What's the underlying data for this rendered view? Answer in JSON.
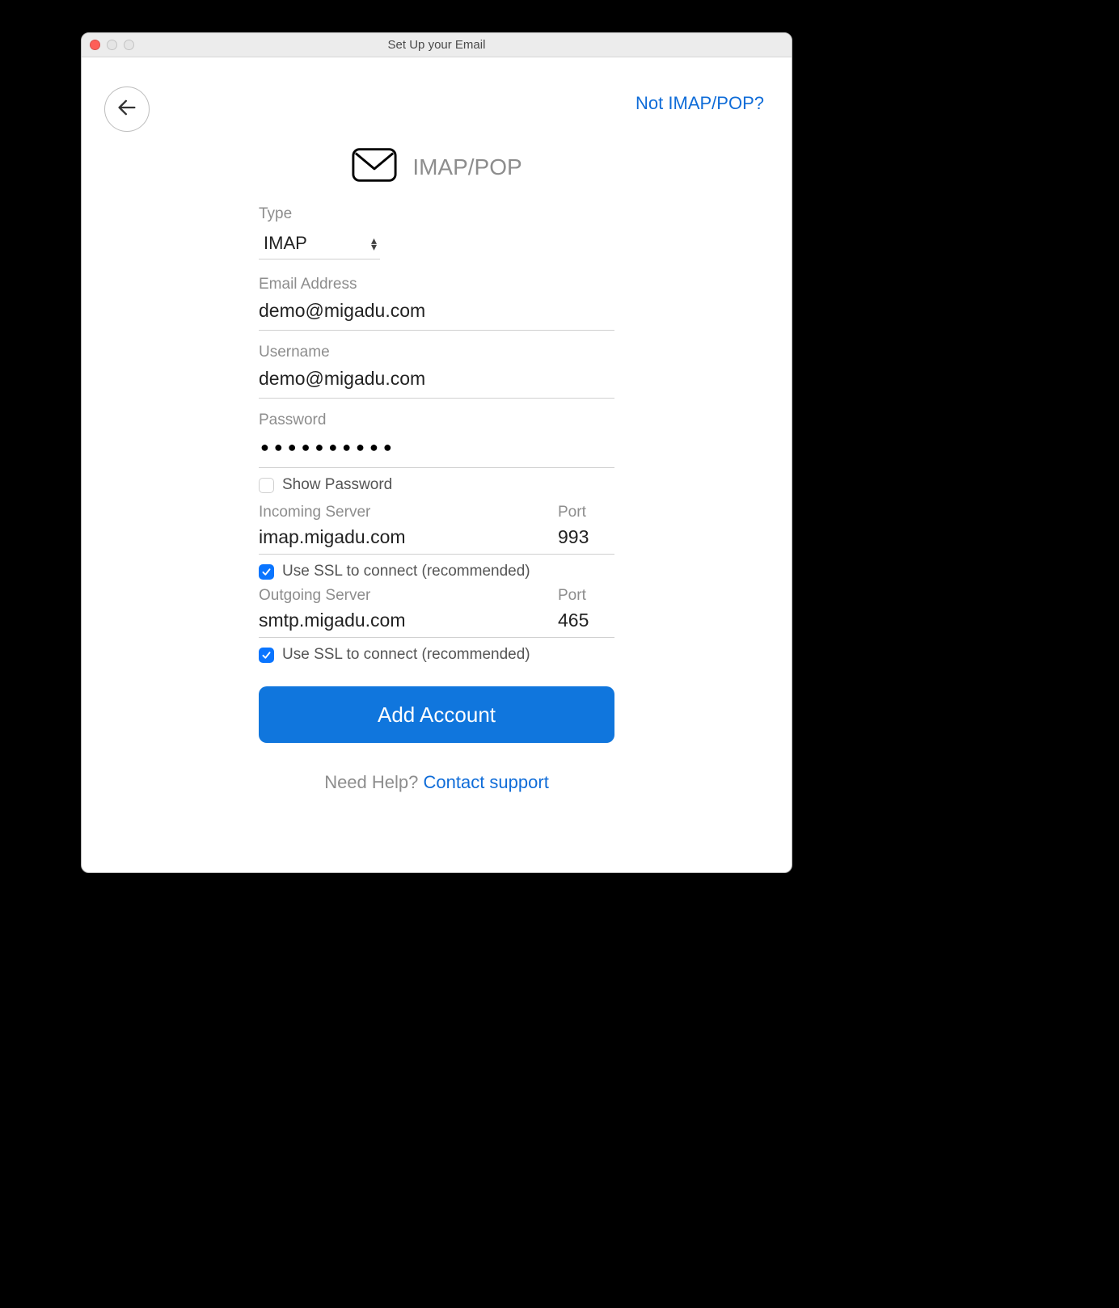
{
  "window": {
    "title": "Set Up your Email"
  },
  "header": {
    "alt_link": "Not IMAP/POP?",
    "title": "IMAP/POP"
  },
  "form": {
    "type_label": "Type",
    "type_value": "IMAP",
    "email_label": "Email Address",
    "email_value": "demo@migadu.com",
    "username_label": "Username",
    "username_value": "demo@migadu.com",
    "password_label": "Password",
    "password_dots": "●●●●●●●●●●",
    "show_password_label": "Show Password",
    "show_password_checked": false,
    "incoming_label": "Incoming Server",
    "incoming_value": "imap.migadu.com",
    "incoming_port_label": "Port",
    "incoming_port_value": "993",
    "incoming_ssl_label": "Use SSL to connect (recommended)",
    "incoming_ssl_checked": true,
    "outgoing_label": "Outgoing Server",
    "outgoing_value": "smtp.migadu.com",
    "outgoing_port_label": "Port",
    "outgoing_port_value": "465",
    "outgoing_ssl_label": "Use SSL to connect (recommended)",
    "outgoing_ssl_checked": true,
    "submit_label": "Add Account"
  },
  "footer": {
    "help_text": "Need Help? ",
    "support_link": "Contact support"
  }
}
